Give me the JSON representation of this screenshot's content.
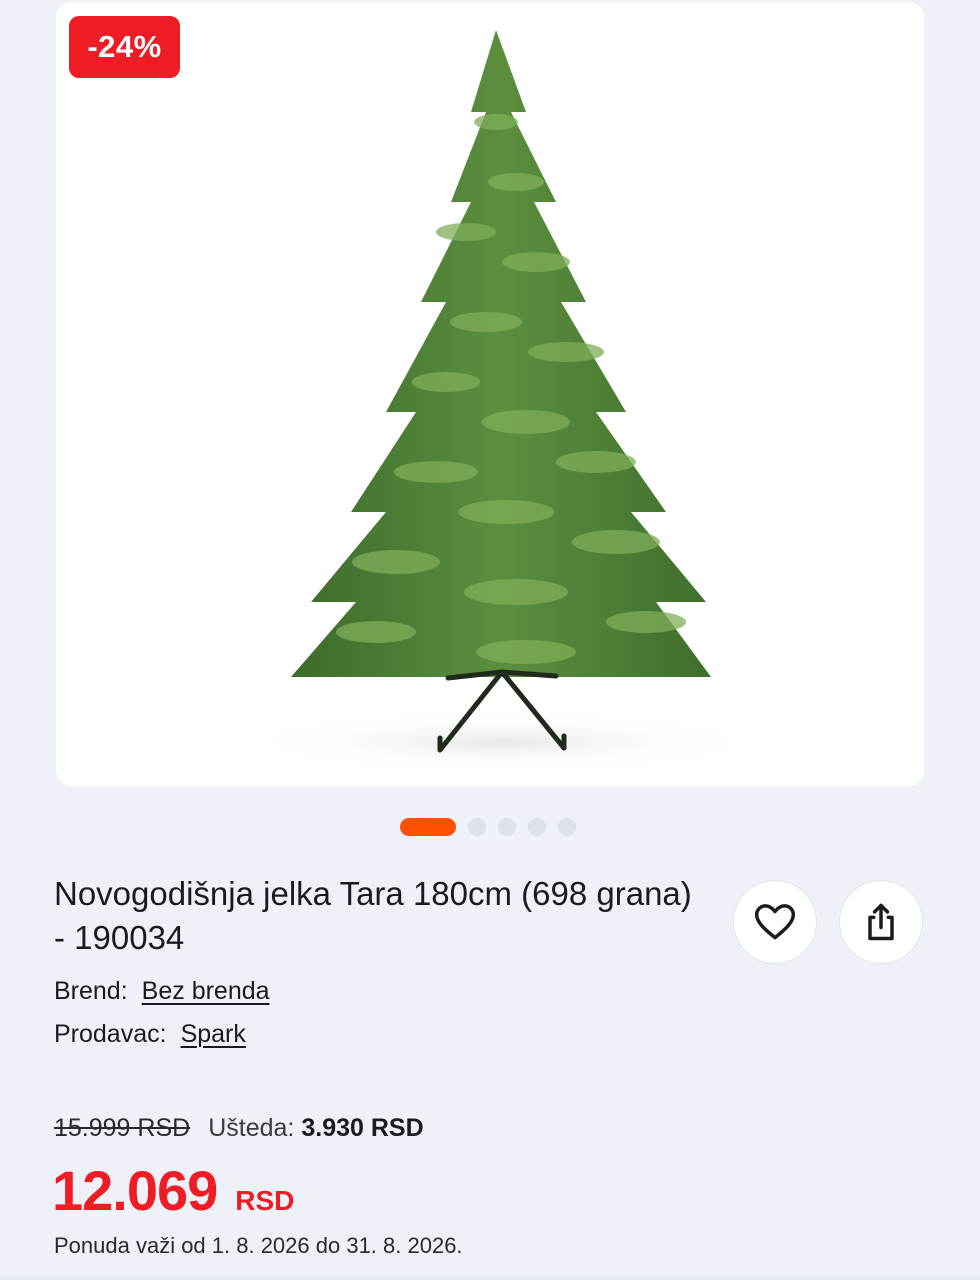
{
  "product": {
    "discount_badge": "-24%",
    "title": "Novogodišnja jelka Tara 180cm (698 grana) - 190034",
    "brand_label": "Brend:",
    "brand_value": "Bez brenda",
    "seller_label": "Prodavac:",
    "seller_value": "Spark",
    "old_price": "15.999 RSD",
    "savings_label": "Ušteda:",
    "savings_value": "3.930 RSD",
    "price": "12.069",
    "currency": "RSD",
    "validity": "Ponuda važi od 1. 8. 2026 do 31. 8. 2026."
  },
  "gallery": {
    "image_count": 5,
    "active_index": 0
  },
  "actions": {
    "favorite_icon": "heart-icon",
    "share_icon": "share-icon"
  },
  "colors": {
    "accent_red": "#ee1c25",
    "active_dot": "#ff4f00",
    "background": "#eef2f8"
  }
}
